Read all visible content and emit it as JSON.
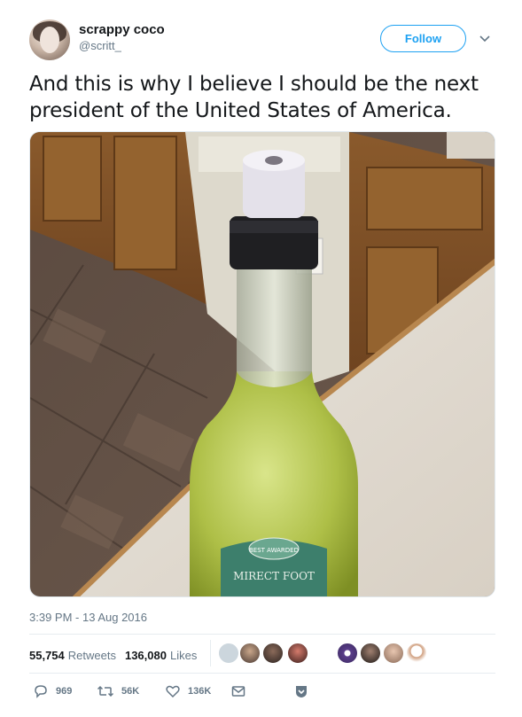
{
  "tweet": {
    "display_name": "scrappy coco",
    "handle": "@scritt_",
    "follow_label": "Follow",
    "text": "And this is why I believe I should be the next president of the United States of America.",
    "timestamp": "3:39 PM - 13 Aug 2016",
    "media": {
      "bottle_label": "MIRECT FOOT",
      "badge_text": "BEST AWARDED"
    },
    "stats": {
      "retweets_count": "55,754",
      "retweets_label": "Retweets",
      "likes_count": "136,080",
      "likes_label": "Likes"
    },
    "actions": {
      "replies": "969",
      "retweets": "56K",
      "likes": "136K"
    }
  },
  "colors": {
    "accent": "#1da1f2",
    "secondary_text": "#657786",
    "primary_text": "#14171a"
  }
}
